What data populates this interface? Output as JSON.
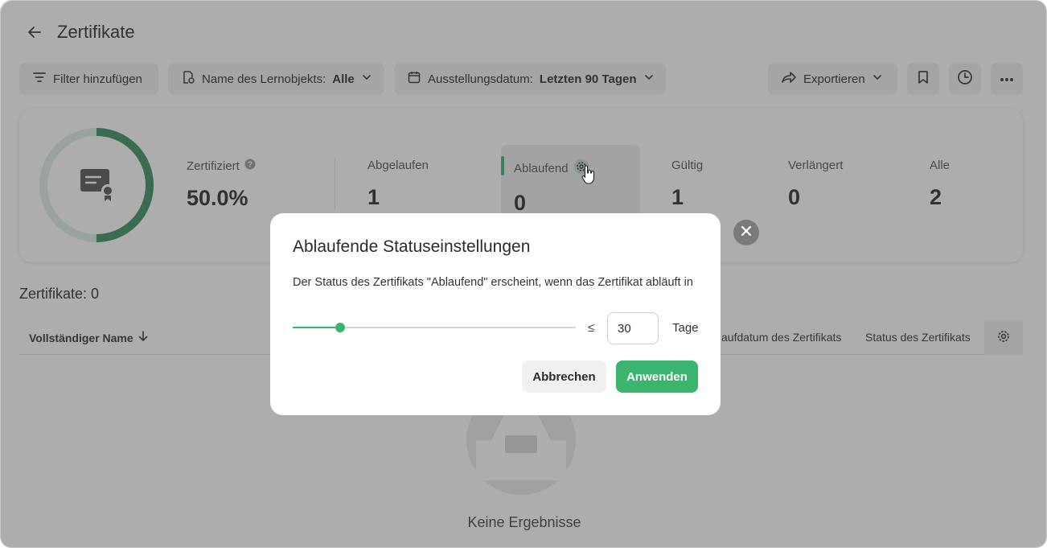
{
  "page": {
    "title": "Zertifikate"
  },
  "toolbar": {
    "add_filter": "Filter hinzufügen",
    "learning_object_label": "Name des Lernobjekts:",
    "learning_object_value": "Alle",
    "issue_date_label": "Ausstellungsdatum:",
    "issue_date_value": "Letzten 90 Tagen",
    "export": "Exportieren"
  },
  "stats": {
    "certified_label": "Zertifiziert",
    "certified_value": "50.0%",
    "certified_fraction": 0.5,
    "expired_label": "Abgelaufen",
    "expired_value": "1",
    "expiring_label": "Ablaufend",
    "expiring_value": "0",
    "valid_label": "Gültig",
    "valid_value": "1",
    "renewed_label": "Verlängert",
    "renewed_value": "0",
    "all_label": "Alle",
    "all_value": "2"
  },
  "table": {
    "count_title": "Zertifikate: 0",
    "columns": {
      "full_name": "Vollständiger Name",
      "expiry_date": "aufdatum des Zertifikats",
      "status": "Status des Zertifikats"
    },
    "empty_text": "Keine Ergebnisse"
  },
  "modal": {
    "title": "Ablaufende Statuseinstellungen",
    "description": "Der Status des Zertifikats \"Ablaufend\" erscheint, wenn das Zertifikat abläuft in",
    "leq": "≤",
    "days_value": "30",
    "days_unit": "Tage",
    "slider_fraction": 0.168,
    "cancel": "Abbrechen",
    "apply": "Anwenden"
  },
  "colors": {
    "accent": "#3bb46e",
    "donut_green": "#3a8f5f",
    "donut_track": "#dfeee5"
  }
}
